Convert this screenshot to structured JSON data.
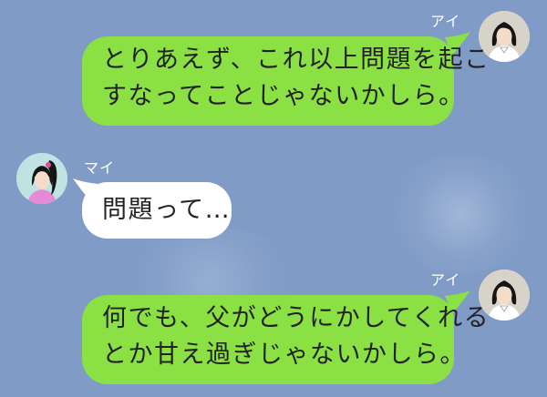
{
  "chat": {
    "messages": [
      {
        "sender": "アイ",
        "side": "right",
        "lines": [
          "とりあえず、これ以上問題を起こ",
          "すなってことじゃないかしら。"
        ]
      },
      {
        "sender": "マイ",
        "side": "left",
        "lines": [
          "問題って…"
        ]
      },
      {
        "sender": "アイ",
        "side": "right",
        "lines": [
          "何でも、父がどうにかしてくれる",
          "とか甘え過ぎじゃないかしら。"
        ]
      }
    ]
  },
  "colors": {
    "background": "#7f9bc6",
    "sent_bubble": "#8be043",
    "received_bubble": "#ffffff"
  },
  "icons": {
    "ai_avatar": "woman-short-black-hair-avatar",
    "mai_avatar": "woman-ponytail-pink-top-avatar"
  }
}
